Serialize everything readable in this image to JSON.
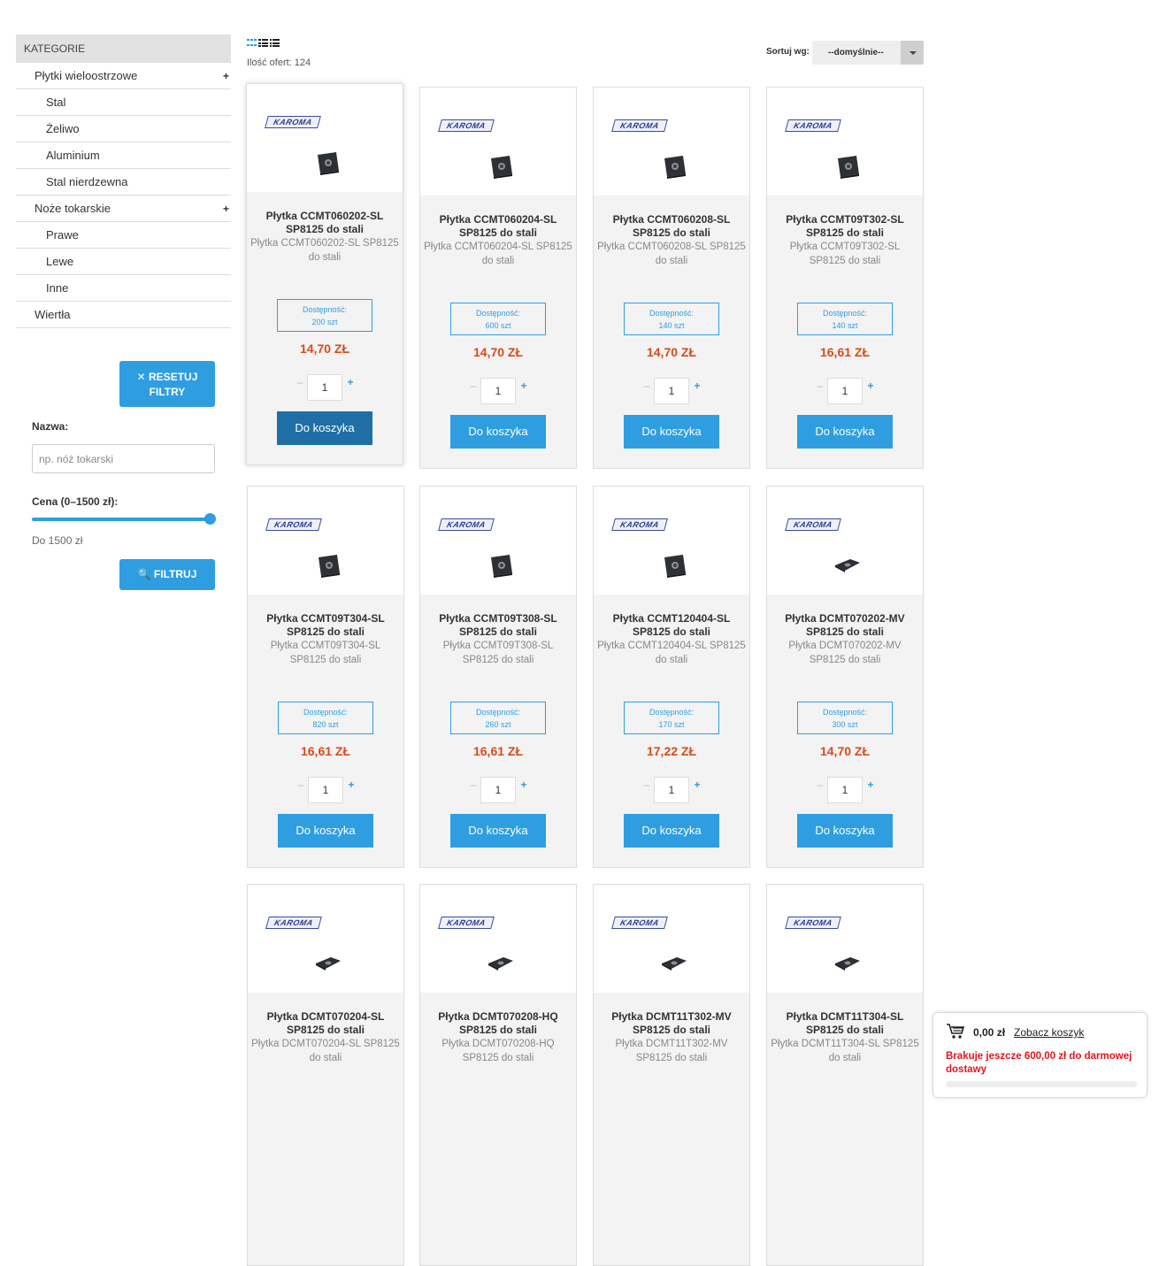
{
  "sidebar": {
    "header": "KATEGORIE",
    "categories": [
      {
        "label": "Płytki wieloostrzowe",
        "level": 1,
        "expand": "+"
      },
      {
        "label": "Stal",
        "level": 2
      },
      {
        "label": "Żeliwo",
        "level": 2
      },
      {
        "label": "Aluminium",
        "level": 2
      },
      {
        "label": "Stal nierdzewna",
        "level": 2
      },
      {
        "label": "Noże tokarskie",
        "level": 1,
        "expand": "+"
      },
      {
        "label": "Prawe",
        "level": 2
      },
      {
        "label": "Lewe",
        "level": 2
      },
      {
        "label": "Inne",
        "level": 2
      },
      {
        "label": "Wiertła",
        "level": 1
      }
    ],
    "reset_line1": "RESETUJ",
    "reset_line2": "FILTRY",
    "name_label": "Nazwa:",
    "name_placeholder": "np. nóż tokarski",
    "price_label": "Cena (0–1500 zł):",
    "price_value_label": "Do 1500 zł",
    "price_slider_value": 1500,
    "filter_button": "FILTRUJ"
  },
  "toolbar": {
    "offer_count": "Ilość ofert: 124",
    "sort_label": "Sortuj wg:",
    "sort_value": "--domyślnie--"
  },
  "products": [
    {
      "brand": "KAROMA",
      "title": "Płytka CCMT060202-SL SP8125 do stali",
      "desc": "Płytka CCMT060202-SL SP8125 do stali",
      "avail_label": "Dostępność:",
      "avail_value": "200 szt",
      "price": "14,70 ZŁ",
      "qty": "1",
      "button": "Do koszyka",
      "shape": "square"
    },
    {
      "brand": "KAROMA",
      "title": "Płytka CCMT060204-SL SP8125 do stali",
      "desc": "Płytka CCMT060204-SL SP8125 do stali",
      "avail_label": "Dostępność:",
      "avail_value": "600 szt",
      "price": "14,70 ZŁ",
      "qty": "1",
      "button": "Do koszyka",
      "shape": "square"
    },
    {
      "brand": "KAROMA",
      "title": "Płytka CCMT060208-SL SP8125 do stali",
      "desc": "Płytka CCMT060208-SL SP8125 do stali",
      "avail_label": "Dostępność:",
      "avail_value": "140 szt",
      "price": "14,70 ZŁ",
      "qty": "1",
      "button": "Do koszyka",
      "shape": "square"
    },
    {
      "brand": "KAROMA",
      "title": "Płytka CCMT09T302-SL SP8125 do stali",
      "desc": "Płytka CCMT09T302-SL SP8125 do stali",
      "avail_label": "Dostępność:",
      "avail_value": "140 szt",
      "price": "16,61 ZŁ",
      "qty": "1",
      "button": "Do koszyka",
      "shape": "square"
    },
    {
      "brand": "KAROMA",
      "title": "Płytka CCMT09T304-SL SP8125 do stali",
      "desc": "Płytka CCMT09T304-SL SP8125 do stali",
      "avail_label": "Dostępność:",
      "avail_value": "820 szt",
      "price": "16,61 ZŁ",
      "qty": "1",
      "button": "Do koszyka",
      "shape": "square"
    },
    {
      "brand": "KAROMA",
      "title": "Płytka CCMT09T308-SL SP8125 do stali",
      "desc": "Płytka CCMT09T308-SL SP8125 do stali",
      "avail_label": "Dostępność:",
      "avail_value": "260 szt",
      "price": "16,61 ZŁ",
      "qty": "1",
      "button": "Do koszyka",
      "shape": "square"
    },
    {
      "brand": "KAROMA",
      "title": "Płytka CCMT120404-SL SP8125 do stali",
      "desc": "Płytka CCMT120404-SL SP8125 do stali",
      "avail_label": "Dostępność:",
      "avail_value": "170 szt",
      "price": "17,22 ZŁ",
      "qty": "1",
      "button": "Do koszyka",
      "shape": "square"
    },
    {
      "brand": "KAROMA",
      "title": "Płytka DCMT070202-MV SP8125 do stali",
      "desc": "Płytka DCMT070202-MV SP8125 do stali",
      "avail_label": "Dostępność:",
      "avail_value": "300 szt",
      "price": "14,70 ZŁ",
      "qty": "1",
      "button": "Do koszyka",
      "shape": "diamond"
    },
    {
      "brand": "KAROMA",
      "title": "Płytka DCMT070204-SL SP8125 do stali",
      "desc": "Płytka DCMT070204-SL SP8125 do stali",
      "shape": "diamond"
    },
    {
      "brand": "KAROMA",
      "title": "Płytka DCMT070208-HQ SP8125 do stali",
      "desc": "Płytka DCMT070208-HQ SP8125 do stali",
      "shape": "diamond"
    },
    {
      "brand": "KAROMA",
      "title": "Płytka DCMT11T302-MV SP8125 do stali",
      "desc": "Płytka DCMT11T302-MV SP8125 do stali",
      "shape": "diamond"
    },
    {
      "brand": "KAROMA",
      "title": "Płytka DCMT11T304-SL SP8125 do stali",
      "desc": "Płytka DCMT11T304-SL SP8125 do stali",
      "shape": "diamond"
    }
  ],
  "cart": {
    "total": "0,00 zł",
    "link": "Zobacz koszyk",
    "message": "Brakuje jeszcze 600,00 zł do darmowej dostawy",
    "progress": 0
  },
  "icons": {
    "view_grid": "grid-view-icon",
    "view_list": "list-view-icon",
    "cart": "cart-icon",
    "search": "search-icon",
    "close": "close-icon"
  },
  "colors": {
    "accent": "#2e9ee1",
    "price": "#d84a1b",
    "warning": "#e8121a",
    "button_hover": "#1f6fa6"
  }
}
